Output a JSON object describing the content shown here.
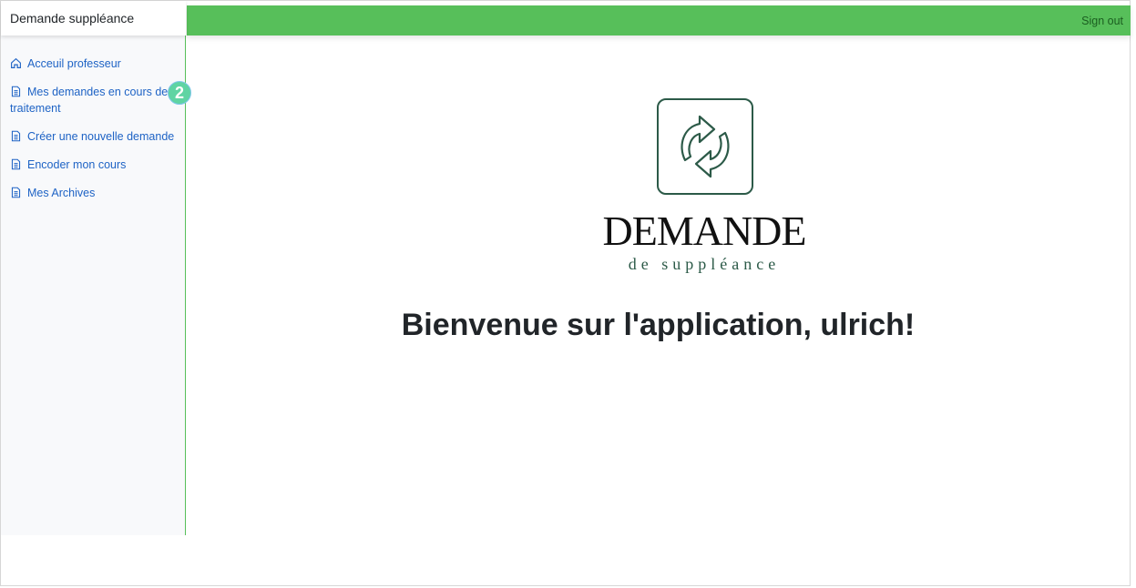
{
  "app": {
    "brand": "Demande suppléance",
    "accent_color": "#57bf5a",
    "link_color": "#1e63c5"
  },
  "header": {
    "sign_out_label": "Sign out"
  },
  "sidebar": {
    "items": [
      {
        "label": "Acceuil professeur",
        "icon": "home-icon"
      },
      {
        "label": "Mes demandes en cours de traitement",
        "icon": "document-icon"
      },
      {
        "label": "Créer une nouvelle demande",
        "icon": "document-icon"
      },
      {
        "label": "Encoder mon cours",
        "icon": "document-icon"
      },
      {
        "label": "Mes Archives",
        "icon": "document-icon"
      }
    ],
    "badge": "2"
  },
  "main": {
    "logo": {
      "icon": "refresh-arrows-icon",
      "word": "DEMANDE",
      "sub": "de suppléance"
    },
    "welcome": "Bienvenue sur l'application, ulrich!"
  }
}
